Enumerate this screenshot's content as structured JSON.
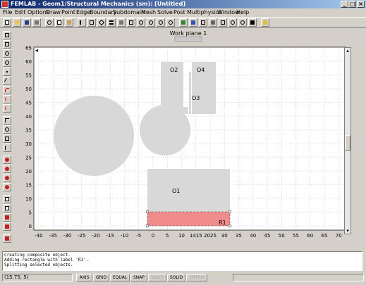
{
  "window": {
    "title": "FEMLAB - Geom1/Structural Mechanics (sm): [Untitled]"
  },
  "menu": [
    "File",
    "Edit",
    "Options",
    "Draw",
    "Point",
    "Edge",
    "Boundary",
    "Subdomain",
    "Mesh",
    "Solve",
    "Post",
    "Multiphysics",
    "Window",
    "Help"
  ],
  "workplane": {
    "label": "Work plane 1"
  },
  "axes": {
    "xlim": [
      -42,
      72
    ],
    "ylim": [
      -3,
      66
    ],
    "xticks": [
      "-40",
      "-35",
      "-30",
      "-25",
      "-20",
      "-15",
      "-10",
      "-5",
      "0",
      "5",
      "10",
      "1415",
      "2025",
      "30",
      "35",
      "40",
      "45",
      "50",
      "55",
      "60",
      "65",
      "70"
    ],
    "yticks": [
      "0",
      "5",
      "10",
      "15",
      "20",
      "25",
      "30",
      "35",
      "40",
      "45",
      "50",
      "55",
      "60",
      "65"
    ]
  },
  "geometry": {
    "labels": {
      "o1": "O1",
      "o2": "O2",
      "o3": "O3",
      "o4": "O4",
      "r1": "R1"
    },
    "shape_color": "#d8d8d8",
    "selected_color": "#f08c8c"
  },
  "console": [
    "Creating composite object.",
    "Adding rectangle with label 'R1'.",
    "Splitting selected objects."
  ],
  "status": {
    "coords": "(15.75, 5)",
    "buttons": [
      {
        "label": "AXIS",
        "enabled": true
      },
      {
        "label": "GRID",
        "enabled": true
      },
      {
        "label": "EQUAL",
        "enabled": true
      },
      {
        "label": "SNAP",
        "enabled": true
      },
      {
        "label": "MULTI",
        "enabled": false
      },
      {
        "label": "SOLID",
        "enabled": true
      },
      {
        "label": "ORTHO",
        "enabled": false
      }
    ]
  }
}
